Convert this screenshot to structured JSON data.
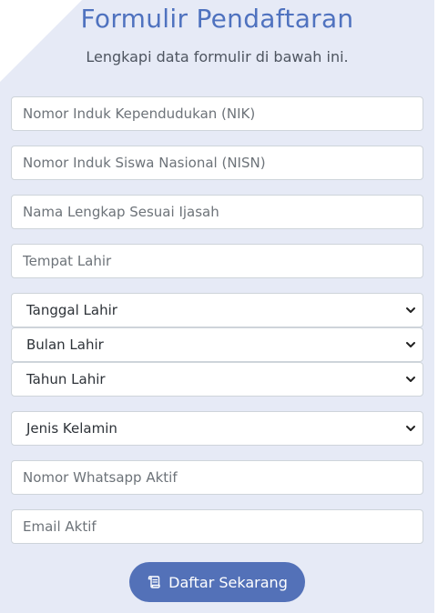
{
  "header": {
    "title": "Formulir Pendaftaran",
    "subtitle": "Lengkapi data formulir di bawah ini."
  },
  "form": {
    "nik_placeholder": "Nomor Induk Kependudukan (NIK)",
    "nisn_placeholder": "Nomor Induk Siswa Nasional (NISN)",
    "nama_placeholder": "Nama Lengkap Sesuai Ijasah",
    "tempat_placeholder": "Tempat Lahir",
    "tanggal_value": "Tanggal Lahir",
    "bulan_value": "Bulan Lahir",
    "tahun_value": "Tahun Lahir",
    "gender_value": "Jenis Kelamin",
    "whatsapp_placeholder": "Nomor Whatsapp Aktif",
    "email_placeholder": "Email Aktif"
  },
  "submit": {
    "label": "Daftar Sekarang",
    "icon": "scroll-icon"
  },
  "colors": {
    "accent": "#5371b8",
    "panel_background": "#e6eaf6",
    "title": "#4f72bf"
  }
}
